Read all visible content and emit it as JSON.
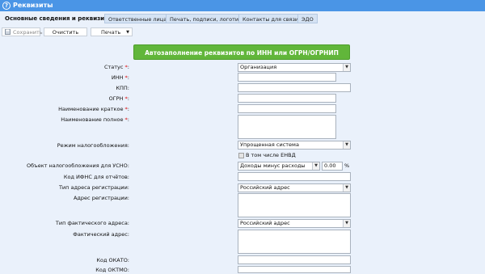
{
  "window": {
    "title": "Реквизиты",
    "help_icon": "?"
  },
  "tabs": [
    {
      "label": "Основные сведения и реквизиты"
    },
    {
      "label": "Ответственные лица"
    },
    {
      "label": "Печать, подписи, логотип"
    },
    {
      "label": "Контакты для связи"
    },
    {
      "label": "ЭДО"
    }
  ],
  "toolbar": {
    "save_label": "Сохранить",
    "clear_label": "Очистить",
    "print_label": "Печать"
  },
  "autofill_button": "Автозаполнение реквизитов по ИНН или ОГРН/ОГРНИП",
  "form": {
    "status": {
      "label": "Статус",
      "value": "Организация"
    },
    "inn": {
      "label": "ИНН",
      "value": ""
    },
    "kpp": {
      "label": "КПП:",
      "value": ""
    },
    "ogrn": {
      "label": "ОГРН",
      "value": ""
    },
    "short_name": {
      "label": "Наименование краткое",
      "value": ""
    },
    "full_name": {
      "label": "Наименование полное",
      "value": ""
    },
    "tax_regime": {
      "label": "Режим налогообложения:",
      "value": "Упрощенная система"
    },
    "envd": {
      "label": "В том числе ЕНВД",
      "checked": false
    },
    "usno_object": {
      "label": "Объект налогообложения для УСНО:",
      "value": "Доходы минус расходы",
      "rate": "0.00",
      "rate_unit": "%"
    },
    "ifns_code": {
      "label": "Код ИФНС для отчётов:",
      "value": ""
    },
    "reg_address_type": {
      "label": "Тип адреса регистрации:",
      "value": "Российский адрес"
    },
    "reg_address": {
      "label": "Адрес регистрации:",
      "value": ""
    },
    "actual_address_type": {
      "label": "Тип фактического адреса:",
      "value": "Российский адрес"
    },
    "actual_address": {
      "label": "Фактический адрес:",
      "value": ""
    },
    "okato": {
      "label": "Код ОКАТО:",
      "value": ""
    },
    "oktmo": {
      "label": "Код ОКТМО:",
      "value": ""
    }
  },
  "colors": {
    "titlebar": "#4a95e6",
    "background": "#eaf1fb",
    "autofill": "#61b63a",
    "required": "#dd0000"
  },
  "icons": {
    "save": "save-icon",
    "dropdown": "chevron-down-icon"
  }
}
